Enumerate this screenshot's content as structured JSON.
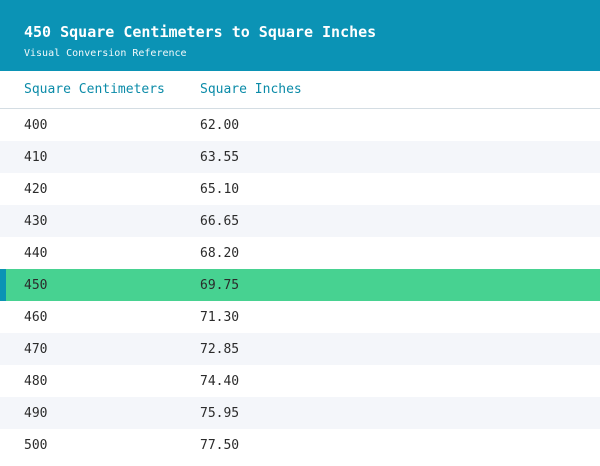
{
  "header": {
    "title": "450 Square Centimeters to Square Inches",
    "subtitle": "Visual Conversion Reference"
  },
  "table": {
    "columns": [
      "Square Centimeters",
      "Square Inches"
    ],
    "rows": [
      {
        "sq_cm": "400",
        "sq_in": "62.00"
      },
      {
        "sq_cm": "410",
        "sq_in": "63.55"
      },
      {
        "sq_cm": "420",
        "sq_in": "65.10"
      },
      {
        "sq_cm": "430",
        "sq_in": "66.65"
      },
      {
        "sq_cm": "440",
        "sq_in": "68.20"
      },
      {
        "sq_cm": "450",
        "sq_in": "69.75",
        "highlighted": true
      },
      {
        "sq_cm": "460",
        "sq_in": "71.30"
      },
      {
        "sq_cm": "470",
        "sq_in": "72.85"
      },
      {
        "sq_cm": "480",
        "sq_in": "74.40"
      },
      {
        "sq_cm": "490",
        "sq_in": "75.95"
      },
      {
        "sq_cm": "500",
        "sq_in": "77.50"
      }
    ]
  },
  "colors": {
    "header_bg": "#0b93b5",
    "highlight_bg": "#47d291",
    "accent": "#0b93b5"
  }
}
